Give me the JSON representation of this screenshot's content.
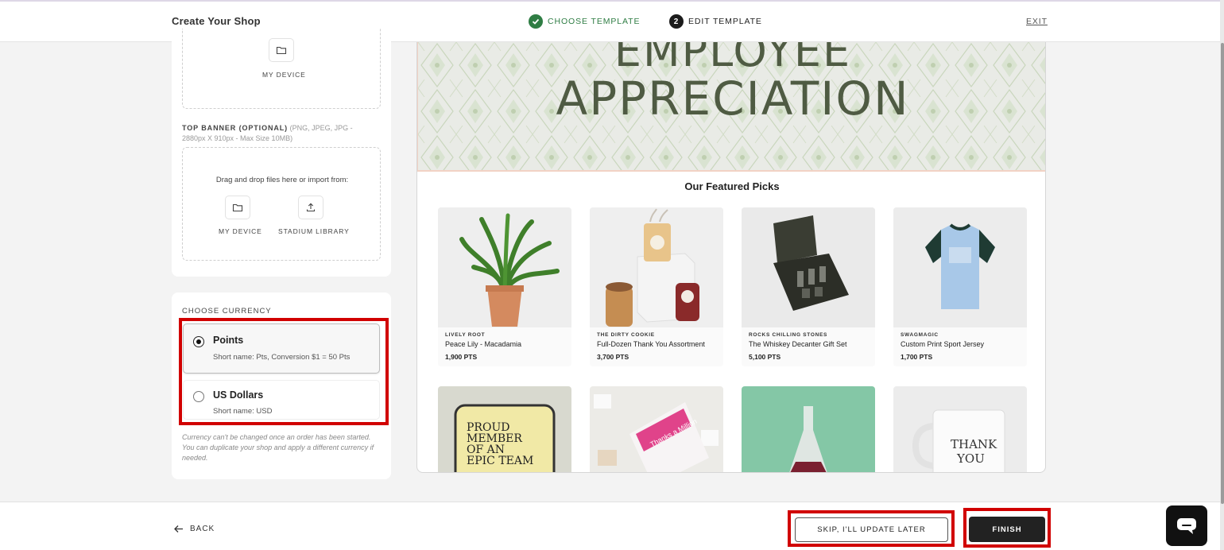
{
  "header": {
    "title": "Create Your Shop",
    "step1": {
      "label": "CHOOSE TEMPLATE",
      "icon": "check-icon"
    },
    "step2": {
      "number": "2",
      "label": "EDIT TEMPLATE"
    },
    "exit_label": "EXIT"
  },
  "upload": {
    "logo_source_label": "MY DEVICE",
    "banner_label": "TOP BANNER (OPTIONAL)",
    "banner_hint": "(PNG, JPEG, JPG - 2880px X 910px - Max Size 10MB)",
    "drag_text": "Drag and drop files here or import from:",
    "my_device_label": "MY DEVICE",
    "library_label": "STADIUM LIBRARY"
  },
  "currency": {
    "heading": "CHOOSE CURRENCY",
    "options": [
      {
        "name": "Points",
        "short": "Short name: Pts, Conversion $1 = 50 Pts",
        "selected": true
      },
      {
        "name": "US Dollars",
        "short": "Short name: USD",
        "selected": false
      }
    ],
    "note": "Currency can't be changed once an order has been started. You can duplicate your shop and apply a different currency if needed."
  },
  "preview": {
    "banner_line1": "EMPLOYEE",
    "banner_line2": "APPRECIATION",
    "featured_title": "Our Featured Picks",
    "products": [
      {
        "brand": "LIVELY ROOT",
        "name": "Peace Lily - Macadamia",
        "price": "1,900 PTS"
      },
      {
        "brand": "THE DIRTY COOKIE",
        "name": "Full-Dozen Thank You Assortment",
        "price": "3,700 PTS"
      },
      {
        "brand": "ROCKS CHILLING STONES",
        "name": "The Whiskey Decanter Gift Set",
        "price": "5,100 PTS"
      },
      {
        "brand": "SWAGMAGIC",
        "name": "Custom Print Sport Jersey",
        "price": "1,700 PTS"
      }
    ],
    "row2": {
      "sleeve_text": [
        "PROUD",
        "MEMBER",
        "OF AN",
        "EPIC TEAM"
      ],
      "chocolate_text": "Thanks a Million",
      "mug_text": [
        "THANK",
        "YOU"
      ]
    }
  },
  "footer": {
    "back_label": "BACK",
    "skip_label": "SKIP, I'LL UPDATE LATER",
    "finish_label": "FINISH"
  },
  "colors": {
    "accent_green": "#2f7d44",
    "annotation_red": "#d10000",
    "banner_text": "#4f5b43"
  }
}
